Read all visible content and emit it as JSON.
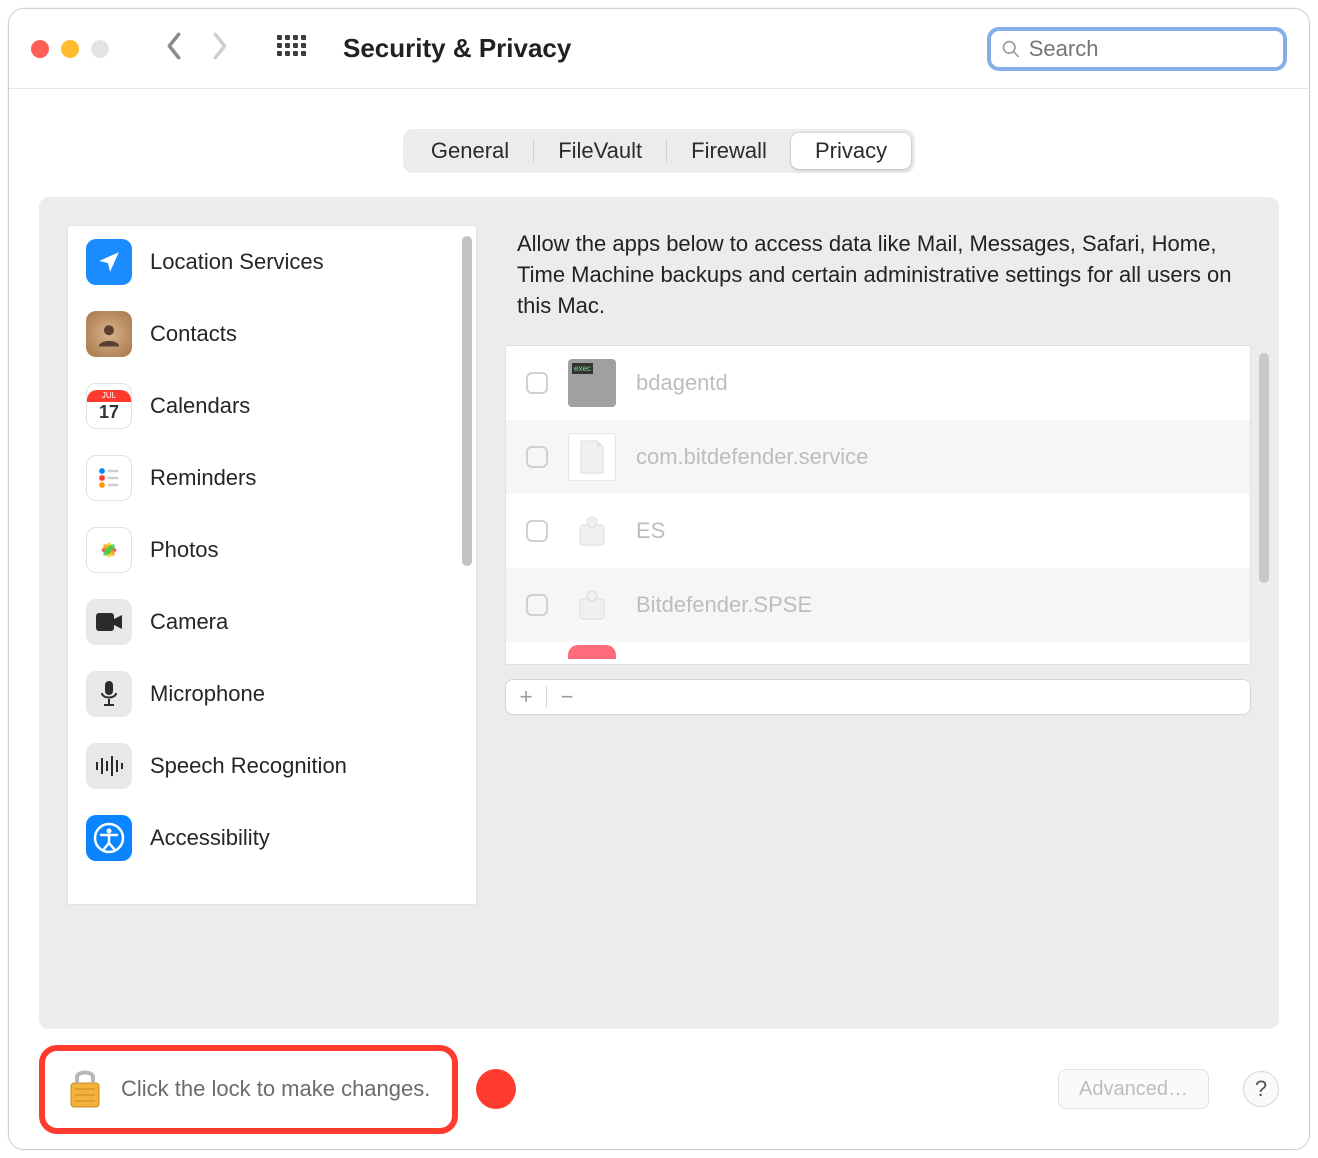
{
  "window": {
    "title": "Security & Privacy"
  },
  "search": {
    "placeholder": "Search"
  },
  "tabs": {
    "general": "General",
    "filevault": "FileVault",
    "firewall": "Firewall",
    "privacy": "Privacy"
  },
  "sidebar": {
    "items": [
      {
        "label": "Location Services"
      },
      {
        "label": "Contacts"
      },
      {
        "label": "Calendars",
        "cal_month": "JUL",
        "cal_day": "17"
      },
      {
        "label": "Reminders"
      },
      {
        "label": "Photos"
      },
      {
        "label": "Camera"
      },
      {
        "label": "Microphone"
      },
      {
        "label": "Speech Recognition"
      },
      {
        "label": "Accessibility"
      }
    ]
  },
  "main": {
    "description": "Allow the apps below to access data like Mail, Messages, Safari, Home, Time Machine backups and certain administrative settings for all users on this Mac.",
    "apps": [
      {
        "name": "bdagentd"
      },
      {
        "name": "com.bitdefender.service"
      },
      {
        "name": "ES"
      },
      {
        "name": "Bitdefender.SPSE"
      }
    ]
  },
  "footer": {
    "lock_text": "Click the lock to make changes.",
    "advanced": "Advanced…",
    "help": "?"
  }
}
